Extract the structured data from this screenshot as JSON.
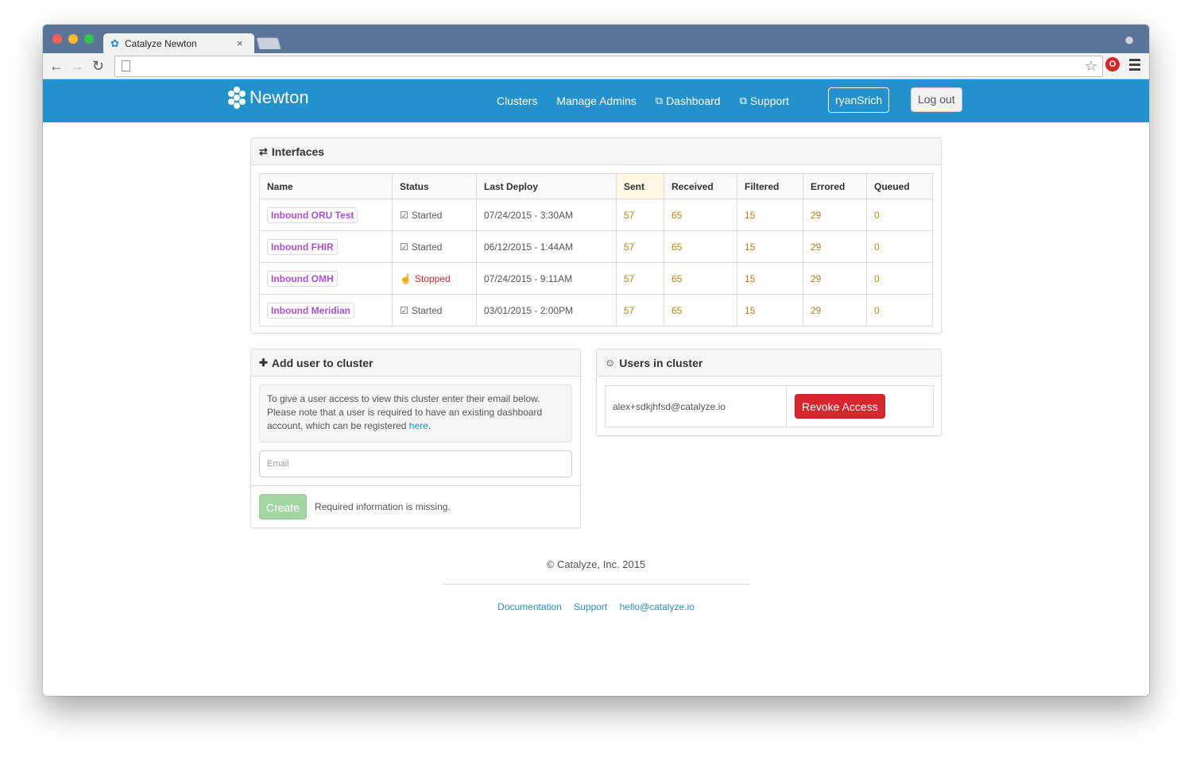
{
  "browser": {
    "tab_title": "Catalyze Newton",
    "tab_close": "×",
    "url": ""
  },
  "appbar": {
    "brand": "Newton",
    "nav": [
      "Clusters",
      "Manage Admins",
      "Dashboard",
      "Support"
    ],
    "user": "ryanSrich",
    "logout": "Log out"
  },
  "interfaces": {
    "title": "Interfaces",
    "columns": [
      "Name",
      "Status",
      "Last Deploy",
      "Sent",
      "Received",
      "Filtered",
      "Errored",
      "Queued"
    ],
    "rows": [
      {
        "name": "Inbound ORU Test",
        "status": "Started",
        "last_deploy": "07/24/2015 - 3:30AM",
        "sent": "57",
        "received": "65",
        "filtered": "15",
        "errored": "29",
        "queued": "0"
      },
      {
        "name": "Inbound FHIR",
        "status": "Started",
        "last_deploy": "06/12/2015 - 1:44AM",
        "sent": "57",
        "received": "65",
        "filtered": "15",
        "errored": "29",
        "queued": "0"
      },
      {
        "name": "Inbound OMH",
        "status": "Stopped",
        "last_deploy": "07/24/2015 - 9:11AM",
        "sent": "57",
        "received": "65",
        "filtered": "15",
        "errored": "29",
        "queued": "0"
      },
      {
        "name": "Inbound Meridian",
        "status": "Started",
        "last_deploy": "03/01/2015 - 2:00PM",
        "sent": "57",
        "received": "65",
        "filtered": "15",
        "errored": "29",
        "queued": "0"
      }
    ]
  },
  "add_user": {
    "title": "Add user to cluster",
    "info_text": "To give a user access to view this cluster enter their email below. Please note that a user is required to have an existing dashboard account, which can be registered",
    "info_link": "here",
    "email_placeholder": "Email",
    "create": "Create",
    "missing": "Required information is missing."
  },
  "users": {
    "title": "Users in cluster",
    "email": "alex+sdkjhfsd@catalyze.io",
    "revoke": "Revoke Access"
  },
  "footer": {
    "copyright": "© Catalyze, Inc. 2015",
    "links": [
      "Documentation",
      "Support",
      "hello@catalyze.io"
    ]
  },
  "colors": {
    "header_blue": "#2391cc",
    "interface_purple": "#a94fd8",
    "number_orange": "#c77c0e",
    "stopped_red": "#d9262c",
    "revoke_red": "#d9262c"
  }
}
